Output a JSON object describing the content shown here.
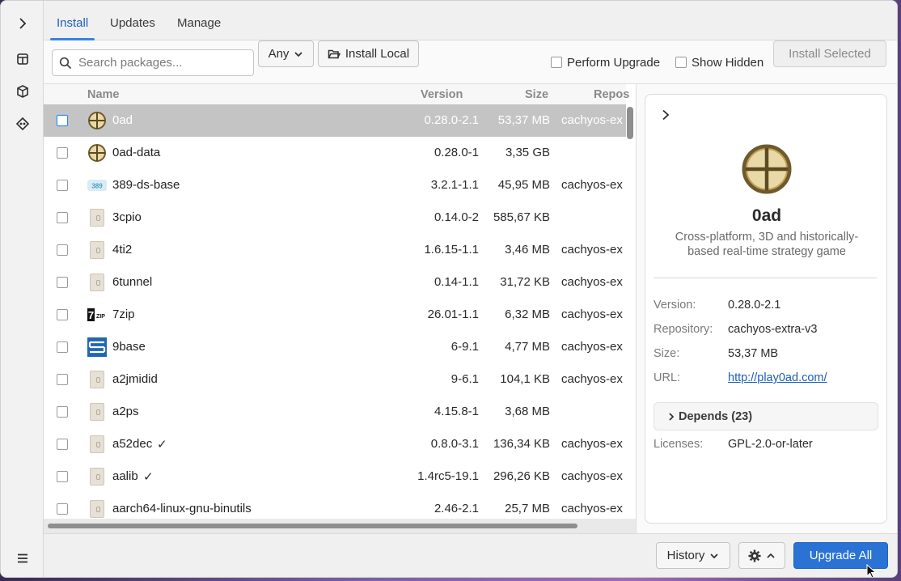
{
  "rail": {
    "icons": [
      "chevron-right-icon",
      "package-icon",
      "box-icon",
      "source-control-icon",
      "menu-icon"
    ]
  },
  "tabs": [
    {
      "label": "Install",
      "active": true
    },
    {
      "label": "Updates",
      "active": false
    },
    {
      "label": "Manage",
      "active": false
    }
  ],
  "toolbar": {
    "search_placeholder": "Search packages...",
    "filter_value": "Any",
    "install_local": "Install Local",
    "perform_upgrade": "Perform Upgrade",
    "show_hidden": "Show Hidden",
    "install_selected": "Install Selected"
  },
  "table": {
    "columns": [
      "Name",
      "Version",
      "Size",
      "Repos"
    ],
    "rows": [
      {
        "name": "0ad",
        "version": "0.28.0-2.1",
        "size": "53,37 MB",
        "repo": "cachyos-ex",
        "icon": "0ad-icon",
        "installed": false,
        "selected": true
      },
      {
        "name": "0ad-data",
        "version": "0.28.0-1",
        "size": "3,35 GB",
        "repo": "",
        "icon": "0ad-icon",
        "installed": false,
        "selected": false
      },
      {
        "name": "389-ds-base",
        "version": "3.2.1-1.1",
        "size": "45,95 MB",
        "repo": "cachyos-ex",
        "icon": "389-ds-icon",
        "installed": false,
        "selected": false
      },
      {
        "name": "3cpio",
        "version": "0.14.0-2",
        "size": "585,67 KB",
        "repo": "",
        "icon": "package-file-icon",
        "installed": false,
        "selected": false
      },
      {
        "name": "4ti2",
        "version": "1.6.15-1.1",
        "size": "3,46 MB",
        "repo": "cachyos-ex",
        "icon": "package-file-icon",
        "installed": false,
        "selected": false
      },
      {
        "name": "6tunnel",
        "version": "0.14-1.1",
        "size": "31,72 KB",
        "repo": "cachyos-ex",
        "icon": "package-file-icon",
        "installed": false,
        "selected": false
      },
      {
        "name": "7zip",
        "version": "26.01-1.1",
        "size": "6,32 MB",
        "repo": "cachyos-ex",
        "icon": "7zip-icon",
        "installed": false,
        "selected": false
      },
      {
        "name": "9base",
        "version": "6-9.1",
        "size": "4,77 MB",
        "repo": "cachyos-ex",
        "icon": "9base-icon",
        "installed": false,
        "selected": false
      },
      {
        "name": "a2jmidid",
        "version": "9-6.1",
        "size": "104,1 KB",
        "repo": "cachyos-ex",
        "icon": "package-file-icon",
        "installed": false,
        "selected": false
      },
      {
        "name": "a2ps",
        "version": "4.15.8-1",
        "size": "3,68 MB",
        "repo": "",
        "icon": "package-file-icon",
        "installed": false,
        "selected": false
      },
      {
        "name": "a52dec",
        "version": "0.8.0-3.1",
        "size": "136,34 KB",
        "repo": "cachyos-ex",
        "icon": "package-file-icon",
        "installed": true,
        "selected": false
      },
      {
        "name": "aalib",
        "version": "1.4rc5-19.1",
        "size": "296,26 KB",
        "repo": "cachyos-ex",
        "icon": "package-file-icon",
        "installed": true,
        "selected": false
      },
      {
        "name": "aarch64-linux-gnu-binutils",
        "version": "2.46-2.1",
        "size": "25,7 MB",
        "repo": "cachyos-ex",
        "icon": "package-file-icon",
        "installed": false,
        "selected": false
      }
    ]
  },
  "detail": {
    "name": "0ad",
    "description": "Cross-platform, 3D and historically-based real-time strategy game",
    "props": [
      {
        "key": "Version:",
        "value": "0.28.0-2.1"
      },
      {
        "key": "Repository:",
        "value": "cachyos-extra-v3"
      },
      {
        "key": "Size:",
        "value": "53,37 MB"
      },
      {
        "key": "URL:",
        "value": "http://play0ad.com/"
      }
    ],
    "depends": "Depends (23)",
    "licenses_key": "Licenses:",
    "licenses_value": "GPL-2.0-or-later"
  },
  "bottom": {
    "history": "History",
    "upgrade_all": "Upgrade All"
  },
  "colors": {
    "accent": "#3584e4",
    "primary_button": "#2a73d4",
    "link": "#1a5fb4"
  }
}
